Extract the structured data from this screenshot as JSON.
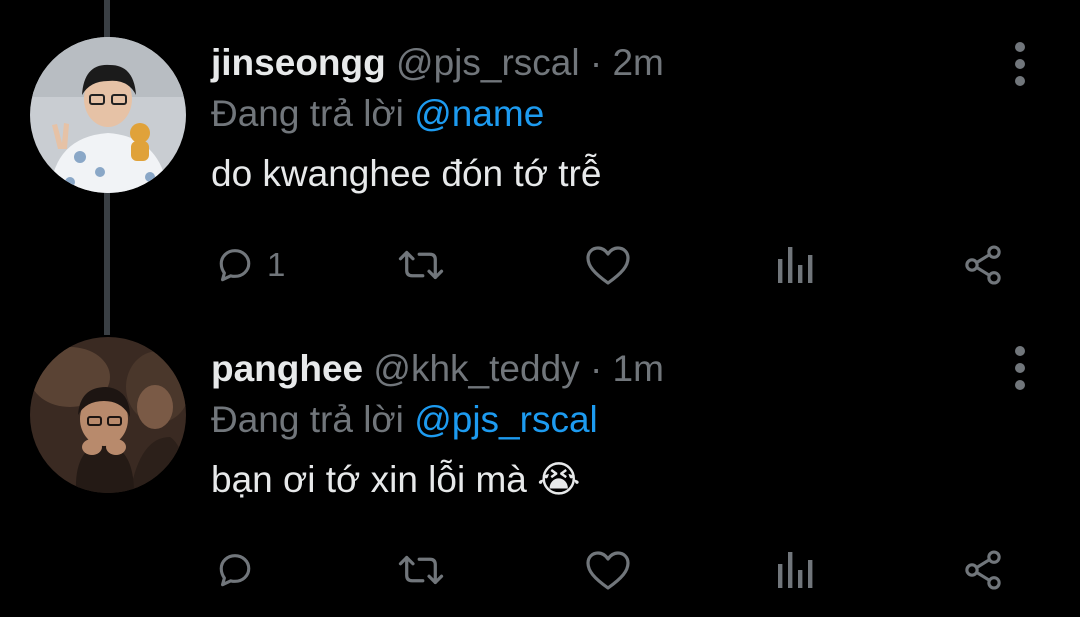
{
  "tweets": [
    {
      "display_name": "jinseongg",
      "handle": "@pjs_rscal",
      "separator": "·",
      "time": "2m",
      "reply_prefix": "Đang trả lời",
      "reply_to": "@name",
      "text": "do kwanghee đón tớ trễ",
      "reply_count": "1",
      "avatar_icon": "avatar-photo"
    },
    {
      "display_name": "panghee",
      "handle": "@khk_teddy",
      "separator": "·",
      "time": "1m",
      "reply_prefix": "Đang trả lời",
      "reply_to": "@pjs_rscal",
      "text": "bạn ơi tớ xin lỗi mà",
      "emoji": "😭",
      "reply_count": "",
      "avatar_icon": "avatar-photo"
    }
  ],
  "colors": {
    "background": "#000000",
    "primary_text": "#e7e9ea",
    "secondary_text": "#71767b",
    "accent": "#1d9bf0",
    "thread_line": "#3a3f44"
  },
  "action_icons": [
    "reply-icon",
    "retweet-icon",
    "like-icon",
    "views-icon",
    "share-icon"
  ]
}
